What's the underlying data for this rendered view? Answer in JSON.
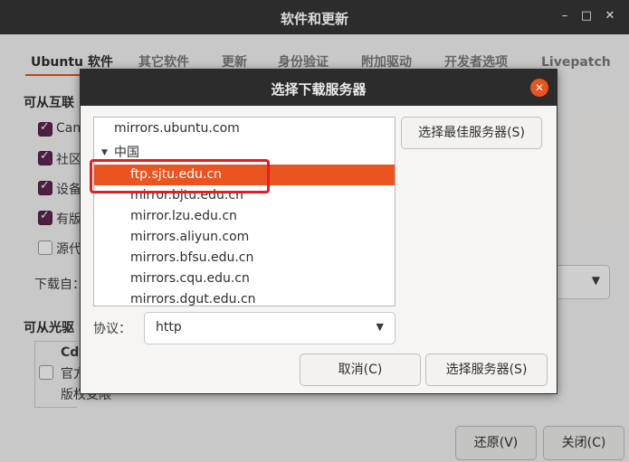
{
  "window": {
    "title": "软件和更新",
    "minimize_glyph": "–",
    "maximize_glyph": "□",
    "close_glyph": "✕"
  },
  "tabs": [
    {
      "label": "Ubuntu 软件",
      "active": true
    },
    {
      "label": "其它软件"
    },
    {
      "label": "更新"
    },
    {
      "label": "身份验证"
    },
    {
      "label": "附加驱动"
    },
    {
      "label": "开发者选项"
    },
    {
      "label": "Livepatch"
    }
  ],
  "background": {
    "internet_section_title": "可从互联",
    "options": [
      {
        "label": "Can",
        "checked": true
      },
      {
        "label": "社区",
        "checked": true
      },
      {
        "label": "设备",
        "checked": true
      },
      {
        "label": "有版",
        "checked": true
      },
      {
        "label": "源代",
        "checked": false
      }
    ],
    "download_from_label": "下载自：",
    "cdrom_section_title": "可从光驱",
    "cdrom_lines": [
      "Cdr",
      "官方",
      "版权受限"
    ]
  },
  "bottom_buttons": {
    "revert": "还原(V)",
    "close": "关闭(C)"
  },
  "dialog": {
    "title": "选择下载服务器",
    "close_glyph": "✕",
    "server_list": [
      {
        "label": "mirrors.ubuntu.com",
        "level": 0
      },
      {
        "label": "中国",
        "level": 0,
        "expander": "▼"
      },
      {
        "label": "ftp.sjtu.edu.cn",
        "level": 1,
        "selected": true
      },
      {
        "label": "mirror.bjtu.edu.cn",
        "level": 1
      },
      {
        "label": "mirror.lzu.edu.cn",
        "level": 1
      },
      {
        "label": "mirrors.aliyun.com",
        "level": 1
      },
      {
        "label": "mirrors.bfsu.edu.cn",
        "level": 1
      },
      {
        "label": "mirrors.cqu.edu.cn",
        "level": 1
      },
      {
        "label": "mirrors.dgut.edu.cn",
        "level": 1
      }
    ],
    "select_best_button": "选择最佳服务器(S)",
    "protocol_label": "协议：",
    "protocol_value": "http",
    "cancel_button": "取消(C)",
    "choose_button": "选择服务器(S)"
  },
  "colors": {
    "accent": "#e95420",
    "checkbox": "#5e2750",
    "titlebar": "#2c2c2c",
    "highlight_box": "#e21f1f"
  }
}
